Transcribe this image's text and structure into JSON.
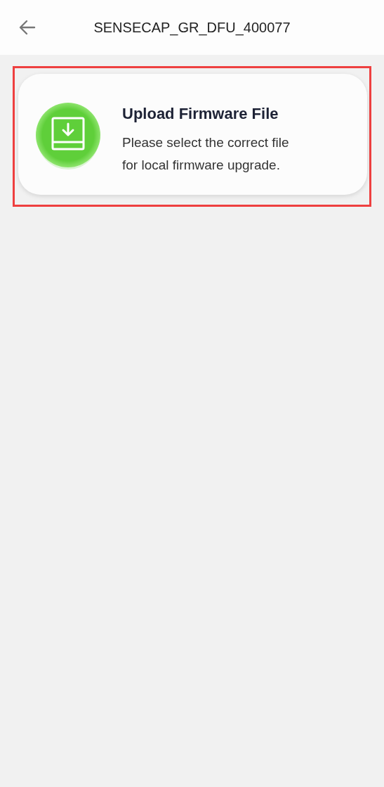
{
  "header": {
    "title": "SENSECAP_GR_DFU_400077"
  },
  "upload_card": {
    "title": "Upload Firmware File",
    "description": "Please select the correct file for local firmware upgrade.",
    "highlighted": true
  }
}
